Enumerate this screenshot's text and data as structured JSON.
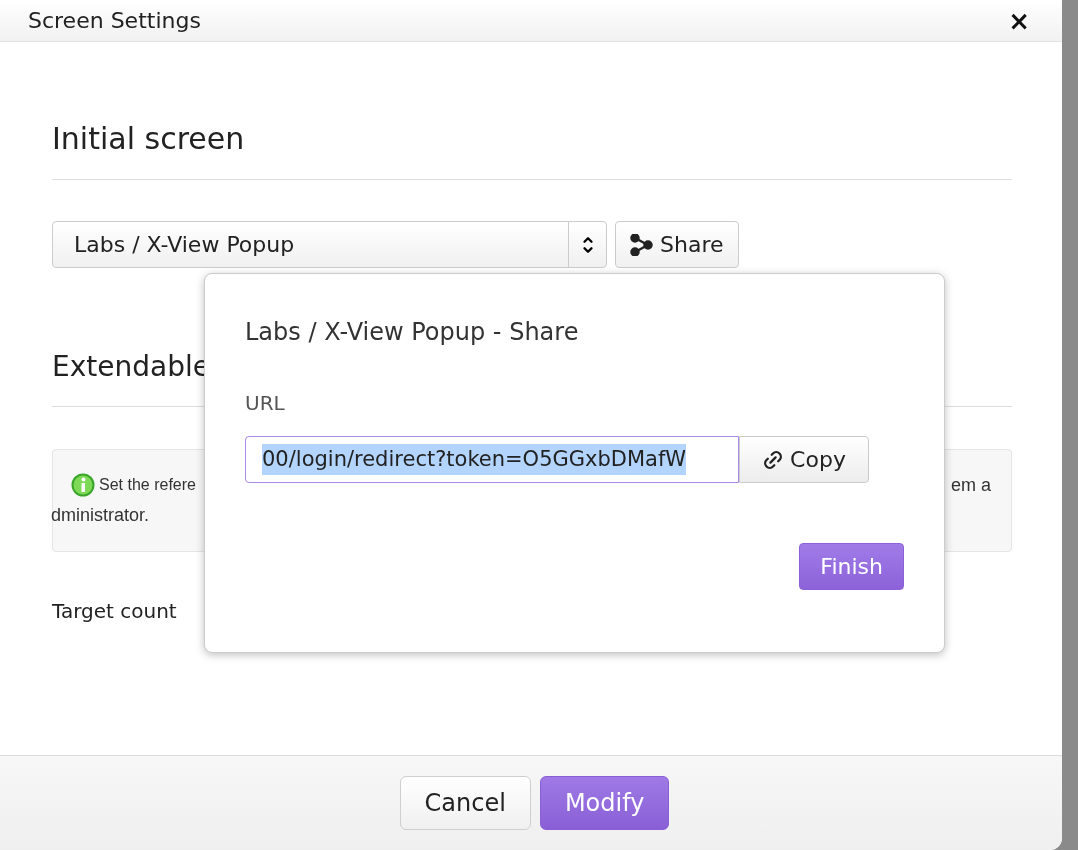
{
  "window": {
    "title": "Screen Settings",
    "close": "×"
  },
  "initial_screen": {
    "heading": "Initial screen",
    "select_value": "Labs / X-View Popup",
    "share_button": "Share"
  },
  "extendable": {
    "heading": "Extendable",
    "info_parts": [
      "Set the refere",
      "em a",
      "dministrator."
    ],
    "target_label": "Target count"
  },
  "footer": {
    "buttons": [
      {
        "label": "Cancel",
        "kind": "secondary"
      },
      {
        "label": "Modify",
        "kind": "primary"
      }
    ]
  },
  "share_popup": {
    "title": "Labs / X-View Popup - Share",
    "url_label": "URL",
    "url_value": "00/login/redirect?token=O5GGxbDMafW",
    "url_selected": true,
    "copy_button": "Copy",
    "finish_button": "Finish"
  }
}
